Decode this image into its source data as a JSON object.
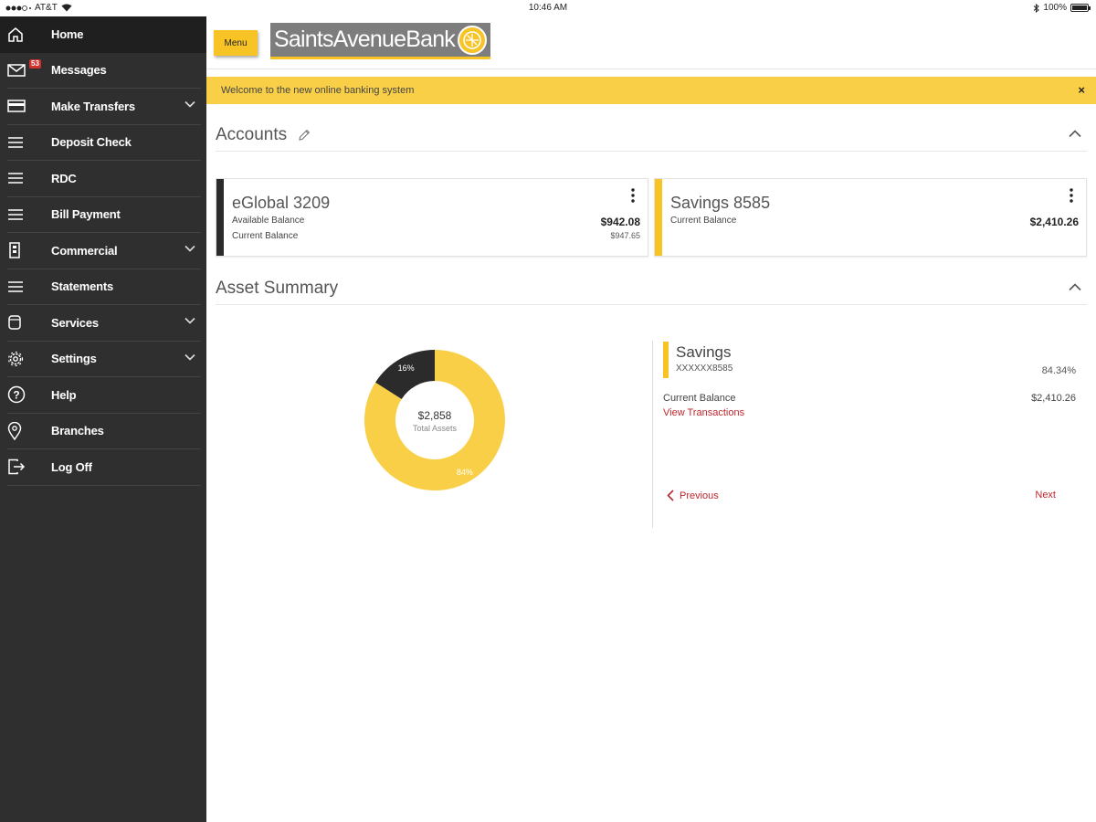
{
  "status_bar": {
    "carrier": "AT&T",
    "time": "10:46 AM",
    "battery": "100%"
  },
  "sidebar": {
    "items": [
      {
        "label": "Home",
        "icon": "home-icon"
      },
      {
        "label": "Messages",
        "icon": "mail-icon",
        "badge": "53"
      },
      {
        "label": "Make Transfers",
        "icon": "card-icon",
        "expandable": true
      },
      {
        "label": "Deposit Check",
        "icon": "hamburger-icon"
      },
      {
        "label": "RDC",
        "icon": "hamburger-icon"
      },
      {
        "label": "Bill Payment",
        "icon": "hamburger-icon"
      },
      {
        "label": "Commercial",
        "icon": "building-icon",
        "expandable": true
      },
      {
        "label": "Statements",
        "icon": "hamburger-icon"
      },
      {
        "label": "Services",
        "icon": "cylinder-icon",
        "expandable": true
      },
      {
        "label": "Settings",
        "icon": "gear-icon",
        "expandable": true
      },
      {
        "label": "Help",
        "icon": "question-icon"
      },
      {
        "label": "Branches",
        "icon": "pin-icon"
      },
      {
        "label": "Log Off",
        "icon": "logout-icon"
      }
    ]
  },
  "header": {
    "menu_label": "Menu",
    "logo_text": "SaintsAvenueBank"
  },
  "banner": {
    "text": "Welcome to the new online banking system",
    "close": "×"
  },
  "accounts": {
    "title": "Accounts",
    "cards": [
      {
        "name": "eGlobal 3209",
        "available_label": "Available Balance",
        "available": "$942.08",
        "current_label": "Current Balance",
        "current": "$947.65",
        "color": "#2b2b2b"
      },
      {
        "name": "Savings 8585",
        "current_label": "Current Balance",
        "current": "$2,410.26",
        "color": "#f7c325"
      }
    ]
  },
  "asset_summary": {
    "title": "Asset Summary",
    "total": "$2,858",
    "total_label": "Total Assets",
    "segments": [
      {
        "label": "16%",
        "fraction": 0.16,
        "color": "#2b2b2b"
      },
      {
        "label": "84%",
        "fraction": 0.84,
        "color": "#f9cf48"
      }
    ],
    "detail": {
      "name": "Savings",
      "number": "XXXXXX8585",
      "percent": "84.34%",
      "balance_label": "Current Balance",
      "balance": "$2,410.26",
      "view_link": "View Transactions",
      "previous": "Previous",
      "next": "Next"
    }
  },
  "colors": {
    "accent": "#f7c325",
    "sidebar": "#2f2f2f",
    "link": "#c0272d"
  }
}
